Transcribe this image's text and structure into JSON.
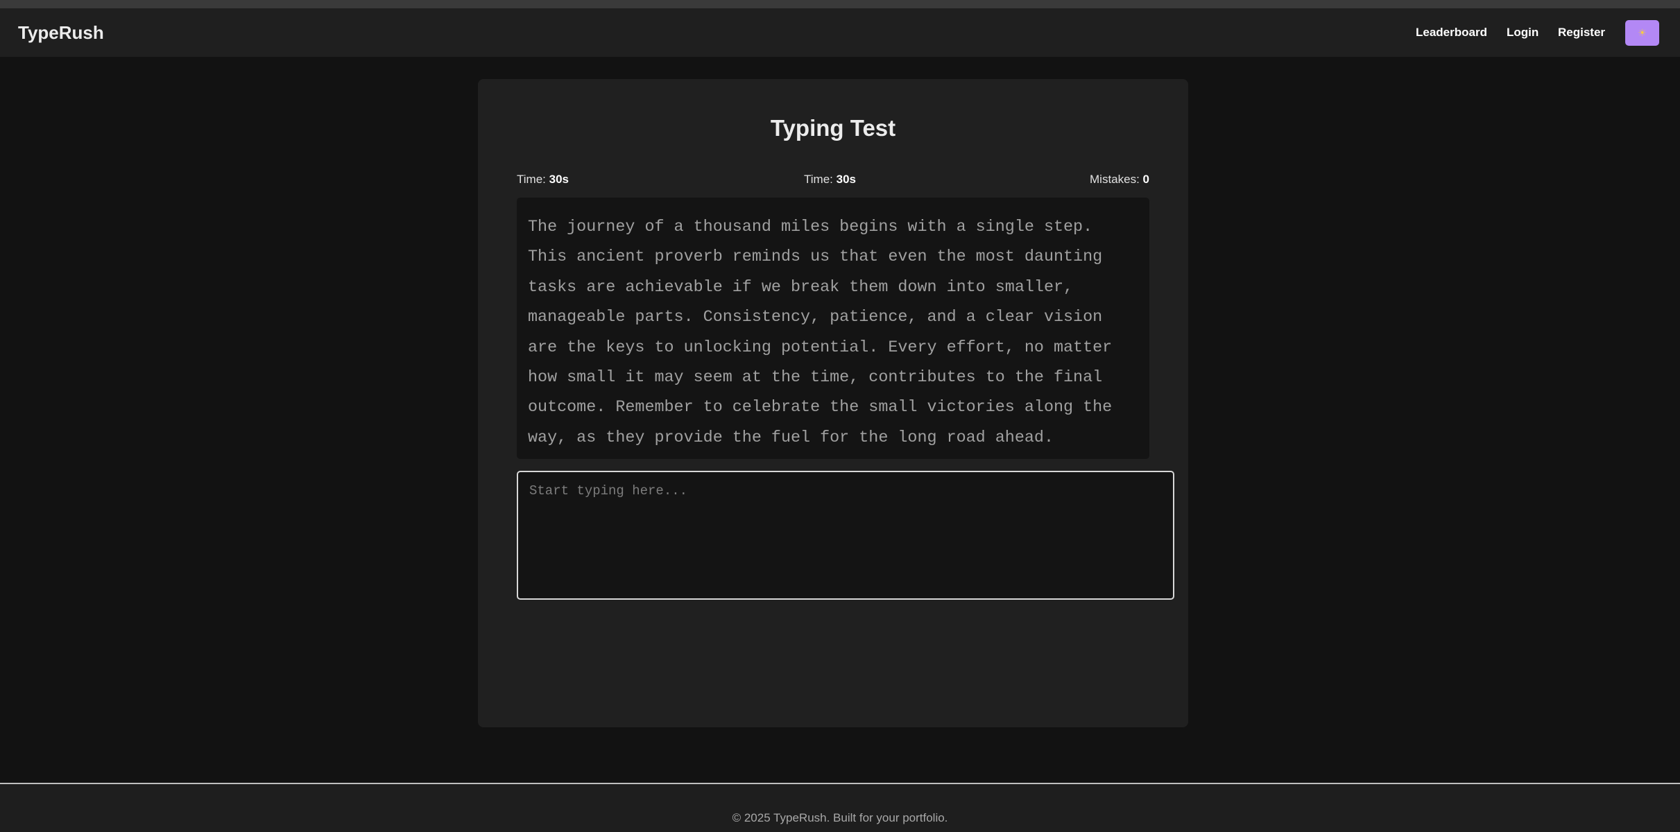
{
  "brand": {
    "name": "TypeRush"
  },
  "nav": {
    "leaderboard": "Leaderboard",
    "login": "Login",
    "register": "Register",
    "theme_toggle_icon": "sun-icon",
    "theme_toggle_glyph": "☀",
    "theme_toggle_color": "#b388f5"
  },
  "test": {
    "title": "Typing Test",
    "stats": [
      {
        "label": "Time:",
        "value": "30s"
      },
      {
        "label": "Time:",
        "value": "30s"
      },
      {
        "label": "Mistakes:",
        "value": "0"
      }
    ],
    "passage": "The journey of a thousand miles begins with a single step. This ancient proverb reminds us that even the most daunting tasks are achievable if we break them down into smaller, manageable parts. Consistency, patience, and a clear vision are the keys to unlocking potential. Every effort, no matter how small it may seem at the time, contributes to the final outcome. Remember to celebrate the small victories along the way, as they provide the fuel for the long road ahead.",
    "input_value": "",
    "input_placeholder": "Start typing here..."
  },
  "footer": {
    "text": "© 2025 TypeRush. Built for your portfolio."
  }
}
